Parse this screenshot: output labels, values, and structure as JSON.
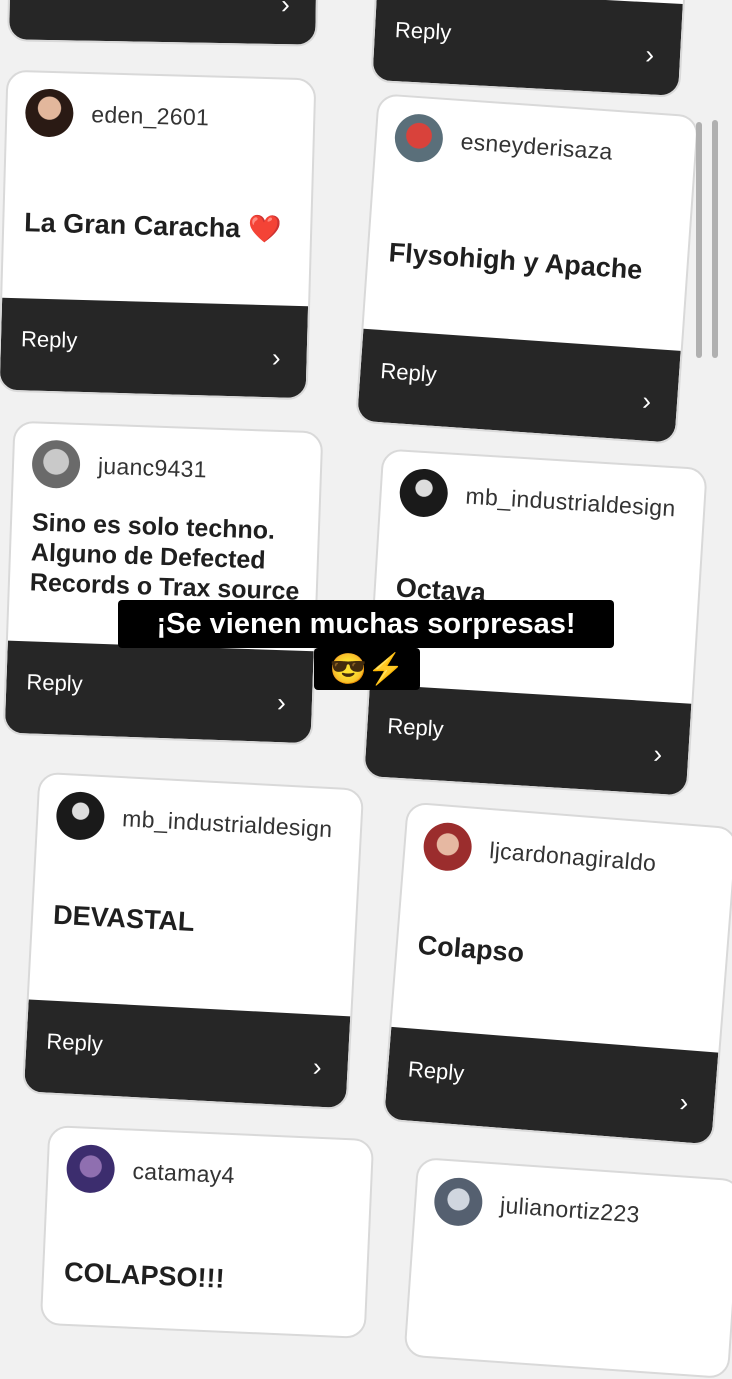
{
  "reply_label": "Reply",
  "cards": [
    {
      "username": "eden_2601",
      "text": "La Gran Caracha ❤️"
    },
    {
      "username": "esneyderisaza",
      "text": "Flysohigh y Apache"
    },
    {
      "username": "juanc9431",
      "text": "Sino es solo techno. Alguno de Defected Records o Trax source"
    },
    {
      "username": "mb_industrialdesign",
      "text": "Octava"
    },
    {
      "username": "mb_industrialdesign",
      "text": "DEVASTAL"
    },
    {
      "username": "ljcardonagiraldo",
      "text": "Colapso"
    },
    {
      "username": "catamay4",
      "text": "COLAPSO!!!"
    },
    {
      "username": "julianortiz223",
      "text": ""
    }
  ],
  "overlay": {
    "line1": "¡Se vienen muchas sorpresas!",
    "line2": "😎⚡"
  },
  "colors": {
    "reply_bar": "#262626",
    "card": "#ffffff",
    "background": "#f1f1f1"
  }
}
